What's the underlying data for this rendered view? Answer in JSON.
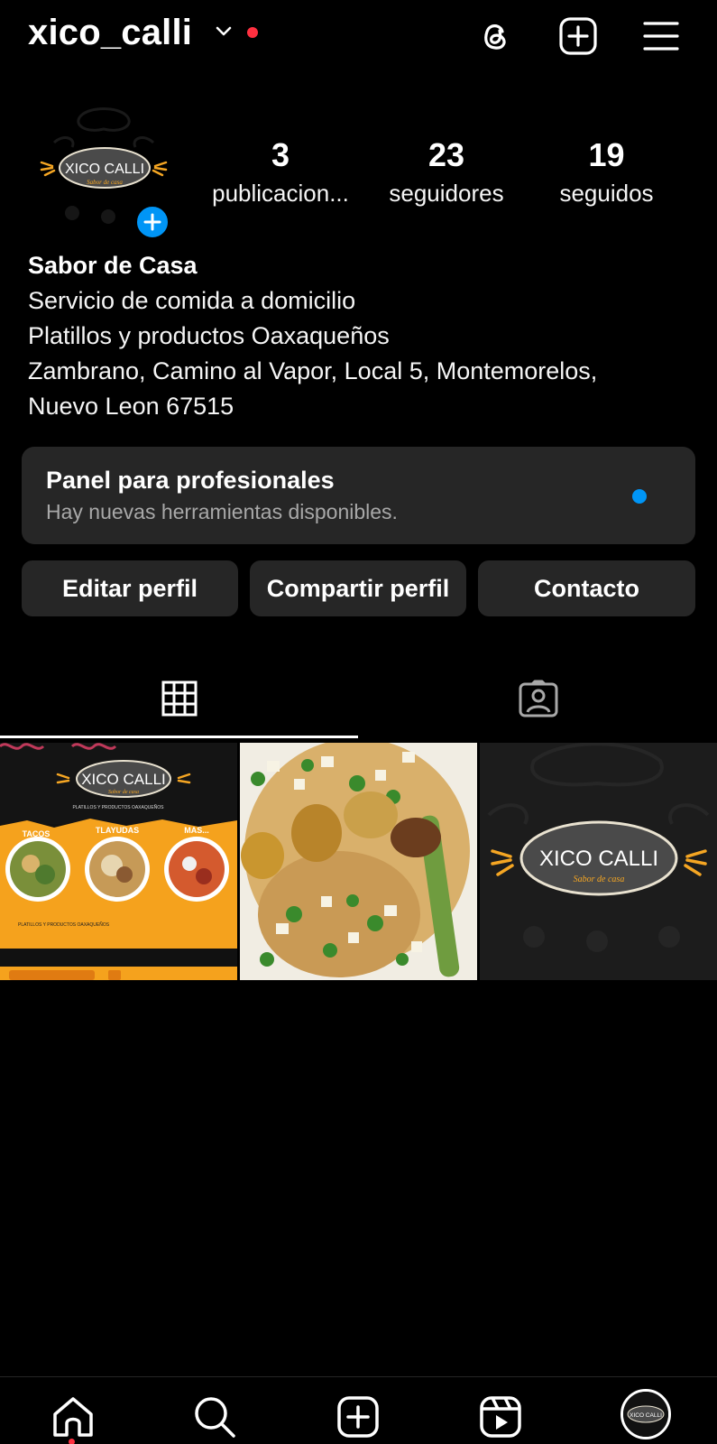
{
  "header": {
    "username": "xico_calli",
    "icons": [
      "chevron-down-icon",
      "threads-icon",
      "new-post-icon",
      "menu-icon"
    ],
    "notification_color": "#ff3040"
  },
  "profile": {
    "stats": {
      "posts_count": "3",
      "posts_label": "publicacion...",
      "followers_count": "23",
      "followers_label": "seguidores",
      "following_count": "19",
      "following_label": "seguidos"
    },
    "bio": {
      "name": "Sabor de Casa",
      "lines": [
        "Servicio de comida a domicilio",
        "Platillos y productos Oaxaqueños",
        "Zambrano, Camino al Vapor, Local 5, Montemorelos,",
        "Nuevo Leon 67515"
      ]
    },
    "logo": {
      "name": "XICO CALLI",
      "tagline": "Sabor de casa"
    }
  },
  "pro_dashboard": {
    "title": "Panel para profesionales",
    "subtitle": "Hay nuevas herramientas disponibles."
  },
  "actions": {
    "edit_label": "Editar perfil",
    "share_label": "Compartir perfil",
    "contact_label": "Contacto"
  },
  "tabs": [
    {
      "icon": "grid-icon",
      "selected": true
    },
    {
      "icon": "tagged-icon",
      "selected": false
    }
  ],
  "posts": {
    "post1": {
      "logo_name": "XICO CALLI",
      "logo_tagline": "Sabor de casa",
      "subtitle": "PLATILLOS Y PRODUCTOS OAXAQUEÑOS",
      "labels": [
        "TACOS",
        "TLAYUDAS",
        "MAS..."
      ],
      "footer": "PLATILLOS Y PRODUCTOS OAXAQUEÑOS"
    },
    "post3": {
      "logo_name": "XICO CALLI",
      "logo_tagline": "Sabor de casa"
    }
  },
  "bottom_nav": {
    "items": [
      "home-icon",
      "search-icon",
      "create-icon",
      "reels-icon",
      "profile-avatar"
    ],
    "profile_logo_name": "XICO CALLI"
  },
  "colors": {
    "accent_blue": "#0095f6",
    "panel_bg": "#262626",
    "muted_text": "#a8a8a8",
    "brand_orange": "#f5a623"
  }
}
